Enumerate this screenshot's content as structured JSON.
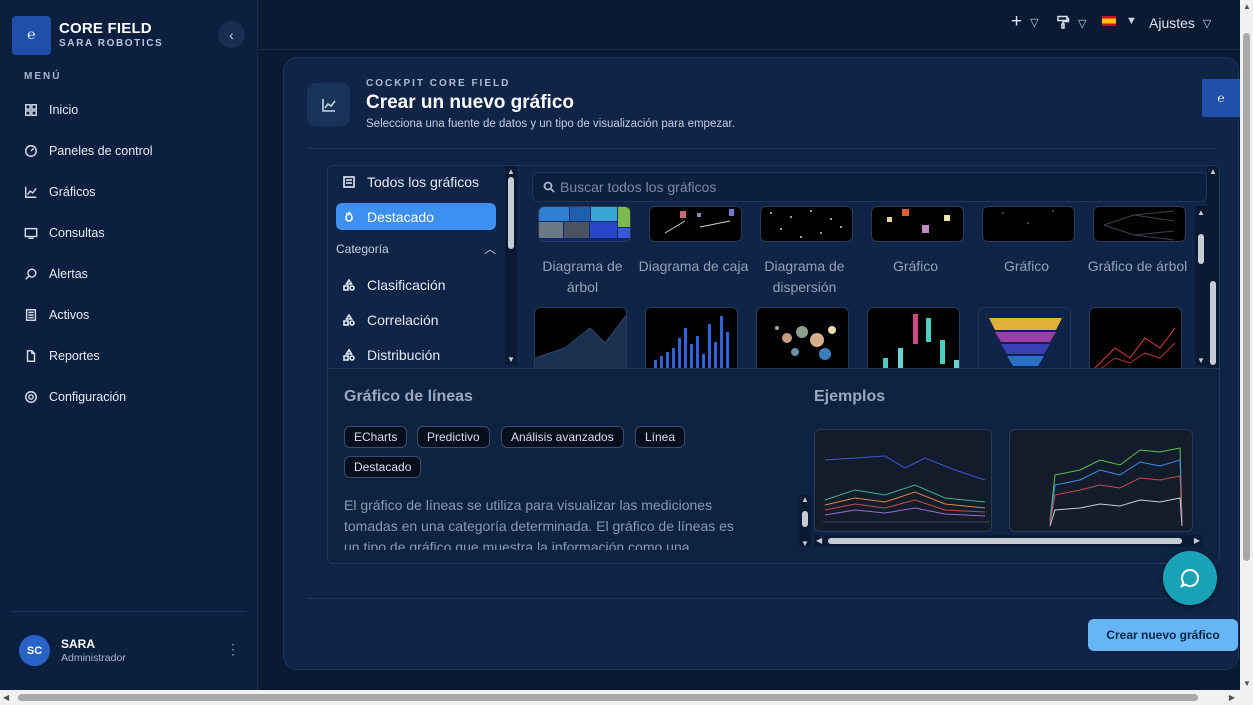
{
  "brand": {
    "title": "CORE FIELD",
    "subtitle": "SARA ROBOTICS",
    "logo_text": "℮"
  },
  "sidebar": {
    "heading": "MENÚ",
    "items": [
      {
        "label": "Inicio",
        "icon": "grid-icon"
      },
      {
        "label": "Paneles de control",
        "icon": "gauge-icon"
      },
      {
        "label": "Gráficos",
        "icon": "line-chart-icon"
      },
      {
        "label": "Consultas",
        "icon": "sql-icon"
      },
      {
        "label": "Alertas",
        "icon": "alert-icon"
      },
      {
        "label": "Activos",
        "icon": "list-icon"
      },
      {
        "label": "Reportes",
        "icon": "file-icon"
      },
      {
        "label": "Configuración",
        "icon": "gear-icon"
      }
    ]
  },
  "user": {
    "initials": "SC",
    "name": "SARA",
    "role": "Administrador"
  },
  "topbar": {
    "settings_label": "Ajustes"
  },
  "header": {
    "eyebrow": "COCKPIT CORE FIELD",
    "title": "Crear un nuevo gráfico",
    "subtitle": "Selecciona una fuente de datos y un tipo de visualización para empezar."
  },
  "categories": {
    "all": "Todos los gráficos",
    "featured": "Destacado",
    "group_label": "Categoría",
    "items": [
      "Clasificación",
      "Correlación",
      "Distribución"
    ]
  },
  "search": {
    "placeholder": "Buscar todos los gráficos"
  },
  "gallery": {
    "row1_labels": [
      "Diagrama de árbol",
      "Diagrama de caja",
      "Diagrama de dispersión",
      "Gráfico",
      "Gráfico",
      "Gráfico de árbol"
    ]
  },
  "details": {
    "title": "Gráfico de líneas",
    "tags": [
      "ECharts",
      "Predictivo",
      "Análisis avanzados",
      "Línea",
      "Destacado"
    ],
    "description": "El gráfico de líneas se utiliza para visualizar las mediciones tomadas en una categoría determinada. El gráfico de líneas es un tipo de gráfico que muestra la información como una",
    "examples_title": "Ejemplos"
  },
  "actions": {
    "create_label": "Crear nuevo gráfico"
  },
  "colors": {
    "accent": "#3d8ff0",
    "primary_button": "#66b6f5",
    "chat": "#1aa3b6"
  }
}
